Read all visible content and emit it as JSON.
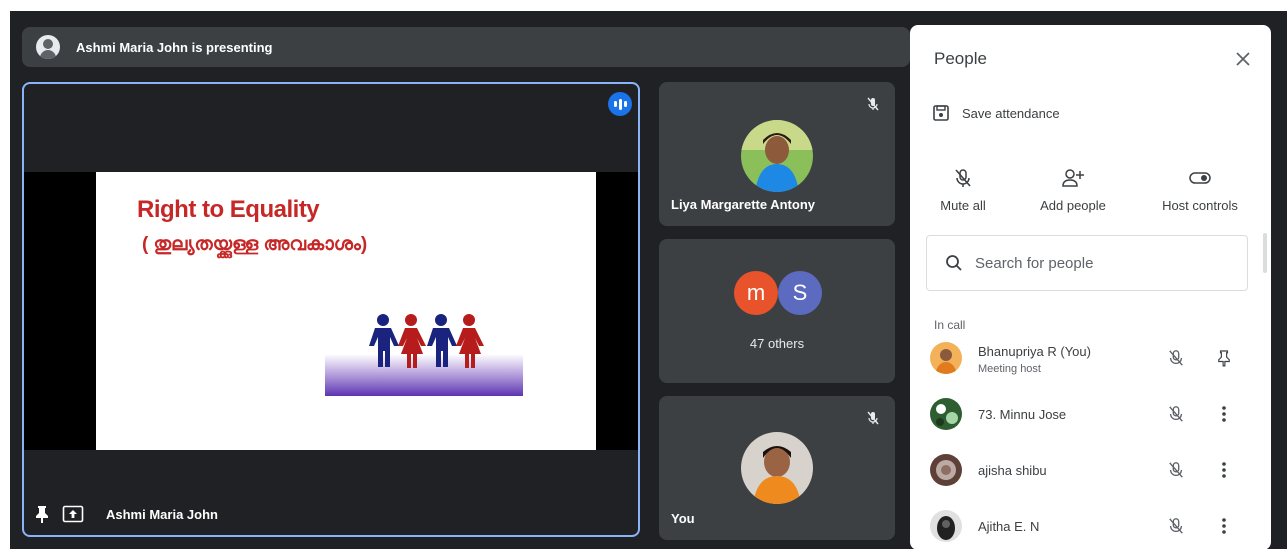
{
  "banner": {
    "text": "Ashmi Maria John is presenting"
  },
  "main_tile": {
    "presenter_name": "Ashmi Maria John",
    "slide": {
      "title": "Right to Equality",
      "subtitle": "( തുല്യതയ്ക്കുള്ള അവകാശം)"
    }
  },
  "tiles": [
    {
      "name": "Liya Margarette Antony",
      "muted": true
    },
    {
      "avatars": [
        "m",
        "S"
      ],
      "label": "47 others"
    },
    {
      "name": "You",
      "muted": true
    }
  ],
  "colors": {
    "avatar_m": "#e8532b",
    "avatar_s": "#5c6bc0",
    "accent": "#1a73e8",
    "tile_bg": "#3c4043",
    "frame_bg": "#202124"
  },
  "panel": {
    "title": "People",
    "save_attendance": "Save attendance",
    "actions": {
      "mute_all": "Mute all",
      "add_people": "Add people",
      "host_controls": "Host controls"
    },
    "search": {
      "placeholder": "Search for people"
    },
    "section_label": "In call",
    "participants": [
      {
        "name": "Bhanupriya R (You)",
        "role": "Meeting host",
        "trailing_icon": "pin-icon"
      },
      {
        "name": "73. Minnu Jose",
        "role": "",
        "trailing_icon": "more-vert-icon"
      },
      {
        "name": "ajisha shibu",
        "role": "",
        "trailing_icon": "more-vert-icon"
      },
      {
        "name": "Ajitha E. N",
        "role": "",
        "trailing_icon": "more-vert-icon"
      }
    ]
  }
}
